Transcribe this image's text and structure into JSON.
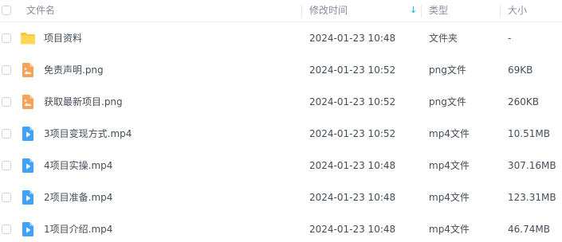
{
  "header": {
    "name_label": "文件名",
    "mtime_label": "修改时间",
    "sort_indicator": "↓",
    "type_label": "类型",
    "size_label": "大小"
  },
  "colors": {
    "accent": "#06a7ff",
    "folder": "#ffc73d",
    "image_file": "#f5a25a",
    "video_file": "#3fa2f8"
  },
  "files": [
    {
      "icon": "folder-icon",
      "name": "项目资料",
      "mtime": "2024-01-23 10:48",
      "type": "文件夹",
      "size": "-"
    },
    {
      "icon": "image-file-icon",
      "name": "免责声明.png",
      "mtime": "2024-01-23 10:52",
      "type": "png文件",
      "size": "69KB"
    },
    {
      "icon": "image-file-icon",
      "name": "获取最新项目.png",
      "mtime": "2024-01-23 10:52",
      "type": "png文件",
      "size": "260KB"
    },
    {
      "icon": "video-file-icon",
      "name": "3项目变现方式.mp4",
      "mtime": "2024-01-23 10:52",
      "type": "mp4文件",
      "size": "10.51MB"
    },
    {
      "icon": "video-file-icon",
      "name": "4项目实操.mp4",
      "mtime": "2024-01-23 10:48",
      "type": "mp4文件",
      "size": "307.16MB"
    },
    {
      "icon": "video-file-icon",
      "name": "2项目准备.mp4",
      "mtime": "2024-01-23 10:48",
      "type": "mp4文件",
      "size": "123.31MB"
    },
    {
      "icon": "video-file-icon",
      "name": "1项目介绍.mp4",
      "mtime": "2024-01-23 10:48",
      "type": "mp4文件",
      "size": "46.74MB"
    }
  ]
}
